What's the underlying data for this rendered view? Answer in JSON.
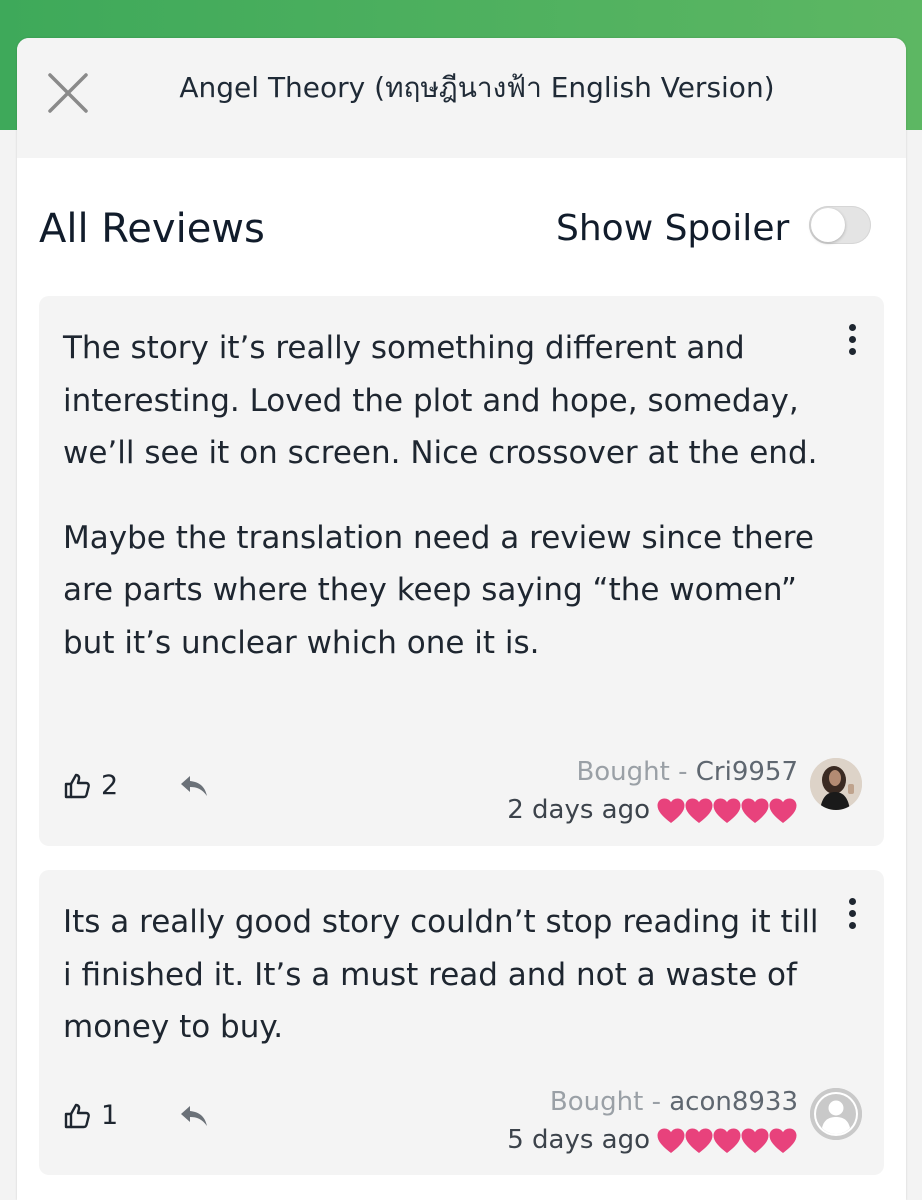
{
  "modal": {
    "title": "Angel Theory (ทฤษฎีนางฟ้า English Version)",
    "close_icon": "close-icon"
  },
  "section": {
    "title": "All Reviews",
    "spoiler_label": "Show Spoiler",
    "spoiler_enabled": false
  },
  "colors": {
    "brand_green": "#4cb05e",
    "heart_pink": "#e8427c",
    "card_bg": "#f4f4f4"
  },
  "reviews": [
    {
      "paragraphs": [
        "The story it’s really something different and interesting. Loved the plot and hope, someday, we’ll see it on screen. Nice crossover at the end.",
        "Maybe the translation need a review since there are parts where they keep saying “the women” but it’s unclear which one it is."
      ],
      "likes": "2",
      "bought_label": "Bought - ",
      "user": "Cri9957",
      "time": "2 days ago",
      "rating": 5
    },
    {
      "paragraphs": [
        "Its a really good story couldn’t stop reading it till i finished it. It’s a must read and not a waste of money to buy."
      ],
      "likes": "1",
      "bought_label": "Bought - ",
      "user": "acon8933",
      "time": "5 days ago",
      "rating": 5
    }
  ]
}
